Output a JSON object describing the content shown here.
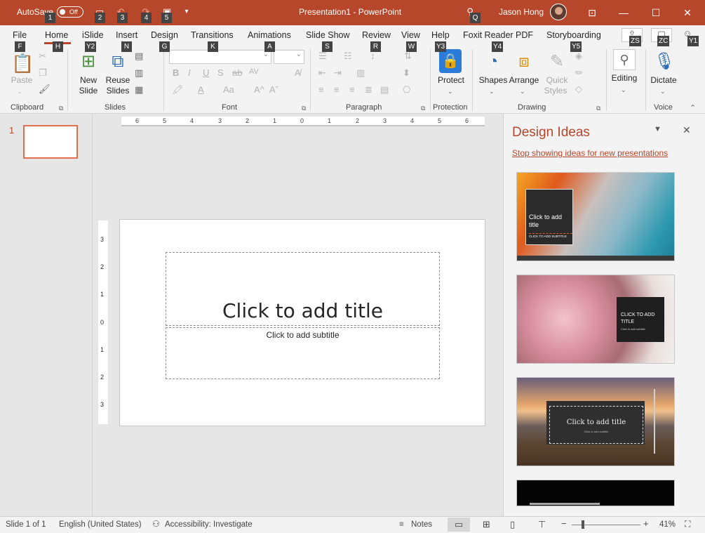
{
  "titlebar": {
    "autosave_label": "AutoSave",
    "toggle_state": "Off",
    "doc_title": "Presentation1  -  PowerPoint",
    "user_name": "Jason Hong",
    "colors": {
      "accent": "#b7472a"
    }
  },
  "quick_access_keytips": [
    "1",
    "2",
    "3",
    "4",
    "5"
  ],
  "search_keytip": "Q",
  "tabs": [
    {
      "label": "File",
      "keytip": "F"
    },
    {
      "label": "Home",
      "keytip": "H"
    },
    {
      "label": "iSlide",
      "keytip": "Y2"
    },
    {
      "label": "Insert",
      "keytip": "N"
    },
    {
      "label": "Design",
      "keytip": "G"
    },
    {
      "label": "Transitions",
      "keytip": "K"
    },
    {
      "label": "Animations",
      "keytip": "A"
    },
    {
      "label": "Slide Show",
      "keytip": "S"
    },
    {
      "label": "Review",
      "keytip": "R"
    },
    {
      "label": "View",
      "keytip": "W"
    },
    {
      "label": "Help",
      "keytip": "Y3"
    },
    {
      "label": "Foxit Reader PDF",
      "keytip": "Y4"
    },
    {
      "label": "Storyboarding",
      "keytip": "Y5"
    }
  ],
  "right_keytips": [
    "ZS",
    "ZC",
    "Y1"
  ],
  "ribbon": {
    "clipboard": {
      "label": "Clipboard",
      "paste": "Paste"
    },
    "slides": {
      "label": "Slides",
      "new_slide_1": "New",
      "new_slide_2": "Slide",
      "reuse_1": "Reuse",
      "reuse_2": "Slides"
    },
    "font": {
      "label": "Font"
    },
    "paragraph": {
      "label": "Paragraph"
    },
    "protection": {
      "label": "Protection",
      "protect": "Protect"
    },
    "drawing": {
      "label": "Drawing",
      "shapes": "Shapes",
      "arrange": "Arrange",
      "quick_1": "Quick",
      "quick_2": "Styles"
    },
    "editing": {
      "label": "Editing"
    },
    "voice": {
      "label": "Voice",
      "dictate": "Dictate"
    }
  },
  "thumbnails": {
    "number": "1"
  },
  "slide": {
    "title_placeholder": "Click to add title",
    "subtitle_placeholder": "Click to add subtitle"
  },
  "ruler": {
    "h_labels": [
      "6",
      "5",
      "4",
      "3",
      "2",
      "1",
      "0",
      "1",
      "2",
      "3",
      "4",
      "5",
      "6"
    ],
    "v_labels": [
      "3",
      "2",
      "1",
      "0",
      "1",
      "2",
      "3"
    ]
  },
  "design_ideas": {
    "title": "Design Ideas",
    "link": "Stop showing ideas for new presentations",
    "idea1_title": "Click to add title",
    "idea1_sub": "CLICK TO ADD SUBTITLE",
    "idea2_title": "CLICK TO ADD TITLE",
    "idea2_sub": "Click to add subtitle",
    "idea3_title": "Click to add title",
    "idea3_sub": "Click to add subtitle"
  },
  "status": {
    "slide_count": "Slide 1 of 1",
    "language": "English (United States)",
    "accessibility": "Accessibility: Investigate",
    "notes": "Notes",
    "zoom": "41%"
  }
}
